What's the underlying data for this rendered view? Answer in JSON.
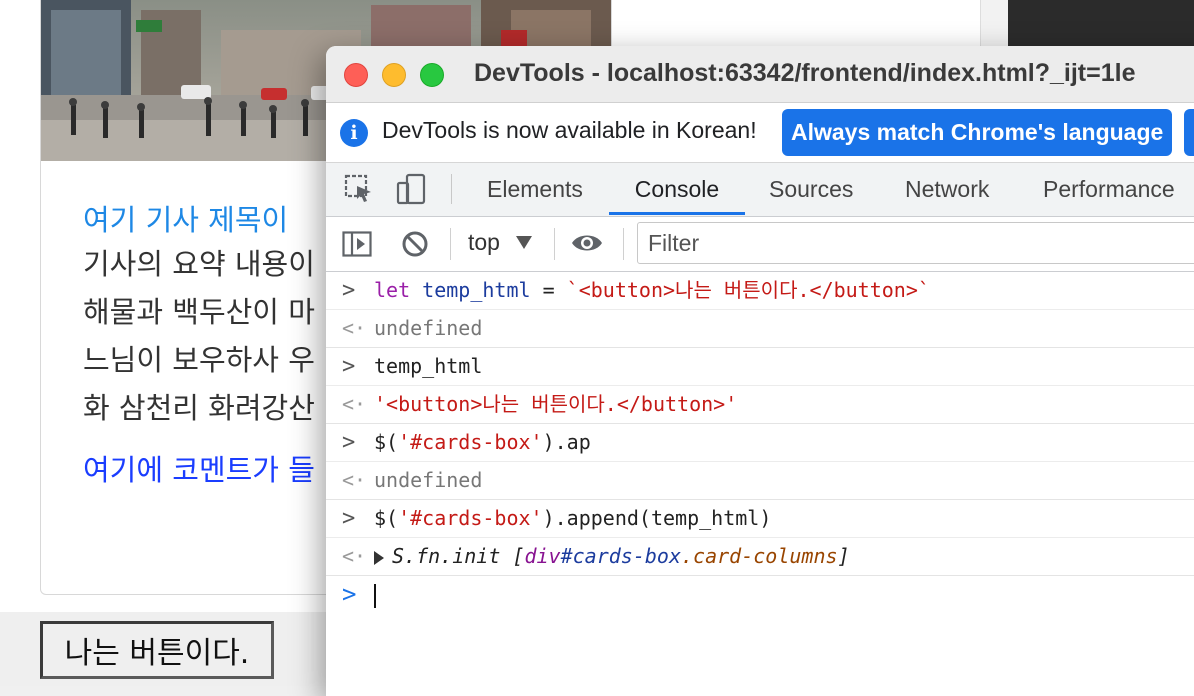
{
  "page": {
    "card_title": "여기 기사 제목이 ",
    "card_lines": [
      "기사의 요약 내용이",
      "해물과 백두산이 마",
      "느님이 보우하사 우",
      "화 삼천리 화려강산"
    ],
    "card_comment": "여기에 코멘트가 들",
    "appended_button_label": "나는 버튼이다."
  },
  "devtools": {
    "window_title": "DevTools - localhost:63342/frontend/index.html?_ijt=1le",
    "info_icon_glyph": "i",
    "info_text": "DevTools is now available in Korean!",
    "match_language_button": "Always match Chrome's language",
    "tabs": [
      "Elements",
      "Console",
      "Sources",
      "Network",
      "Performance"
    ],
    "active_tab": "Console",
    "context": "top",
    "filter_placeholder": "Filter",
    "console": {
      "prompt_glyph": ">",
      "return_glyph": "<·",
      "line1": {
        "kw": "let",
        "var": "temp_html",
        "op": " = ",
        "str": "`<button>나는 버튼이다.</button>`"
      },
      "out1": "undefined",
      "line2": "temp_html",
      "out2": "'<button>나는 버튼이다.</button>'",
      "line3": {
        "pre": "$(",
        "str": "'#cards-box'",
        "post": ").ap"
      },
      "out3": "undefined",
      "line4": {
        "pre": "$(",
        "str": "'#cards-box'",
        "post": ").append(temp_html)"
      },
      "out4": {
        "name": "S.fn.init",
        "open": " [",
        "tag": "div",
        "id": "#cards-box",
        "cls": ".card-columns",
        "close": "]"
      },
      "input_prompt": ">"
    }
  },
  "colors": {
    "accent": "#1a73e8",
    "link_title": "#1e88e5",
    "comment": "#1a3dff",
    "string": "#c41a16",
    "keyword": "#9a1fa8"
  }
}
